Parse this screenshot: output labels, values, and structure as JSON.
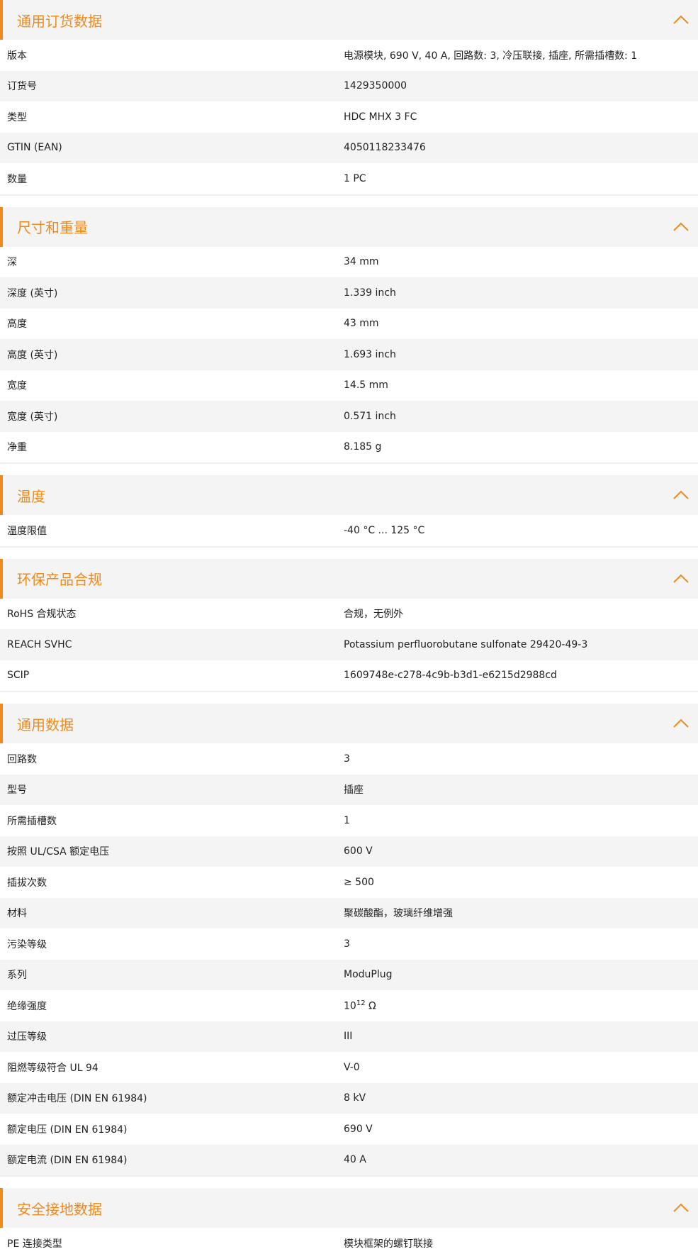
{
  "accent_color": "#f08a1c",
  "sections": [
    {
      "title": "通用订货数据",
      "rows": [
        {
          "label": "版本",
          "value": "电源模块, 690 V, 40 A, 回路数: 3, 冷压联接, 插座, 所需插槽数: 1"
        },
        {
          "label": "订货号",
          "value": "1429350000"
        },
        {
          "label": "类型",
          "value": "HDC MHX 3 FC"
        },
        {
          "label": "GTIN (EAN)",
          "value": "4050118233476"
        },
        {
          "label": "数量",
          "value": "1  PC"
        }
      ]
    },
    {
      "title": "尺寸和重量",
      "rows": [
        {
          "label": "深",
          "value": "34  mm"
        },
        {
          "label": "深度 (英寸)",
          "value": "1.339  inch"
        },
        {
          "label": "高度",
          "value": "43  mm"
        },
        {
          "label": "高度 (英寸)",
          "value": "1.693  inch"
        },
        {
          "label": "宽度",
          "value": "14.5  mm"
        },
        {
          "label": "宽度 (英寸)",
          "value": "0.571  inch"
        },
        {
          "label": "净重",
          "value": "8.185  g"
        }
      ]
    },
    {
      "title": "温度",
      "rows": [
        {
          "label": "温度限值",
          "value": "-40 °C ... 125 °C"
        }
      ]
    },
    {
      "title": "环保产品合规",
      "rows": [
        {
          "label": "RoHS 合规状态",
          "value": "合规，无例外"
        },
        {
          "label": "REACH SVHC",
          "value": "Potassium perfluorobutane sulfonate 29420-49-3"
        },
        {
          "label": "SCIP",
          "value": "1609748e-c278-4c9b-b3d1-e6215d2988cd"
        }
      ]
    },
    {
      "title": "通用数据",
      "rows": [
        {
          "label": "回路数",
          "value": "3"
        },
        {
          "label": "型号",
          "value": "插座"
        },
        {
          "label": "所需插槽数",
          "value": "1"
        },
        {
          "label": "按照 UL/CSA 额定电压",
          "value": "600 V"
        },
        {
          "label": "插拔次数",
          "value": "≥ 500"
        },
        {
          "label": "材料",
          "value": "聚碳酸酯，玻璃纤维增强"
        },
        {
          "label": "污染等级",
          "value": "3"
        },
        {
          "label": "系列",
          "value": "ModuPlug"
        },
        {
          "label": "绝缘强度",
          "value": "10",
          "sup": "12",
          "suffix": " Ω"
        },
        {
          "label": "过压等级",
          "value": "III"
        },
        {
          "label": "阻燃等级符合 UL 94",
          "value": "V-0"
        },
        {
          "label": "额定冲击电压 (DIN EN 61984)",
          "value": "8  kV"
        },
        {
          "label": "额定电压 (DIN EN 61984)",
          "value": "690  V"
        },
        {
          "label": "额定电流 (DIN EN 61984)",
          "value": "40  A"
        }
      ]
    },
    {
      "title": "安全接地数据",
      "rows": [
        {
          "label": "PE 连接类型",
          "value": "模块框架的螺钉联接"
        }
      ]
    }
  ]
}
